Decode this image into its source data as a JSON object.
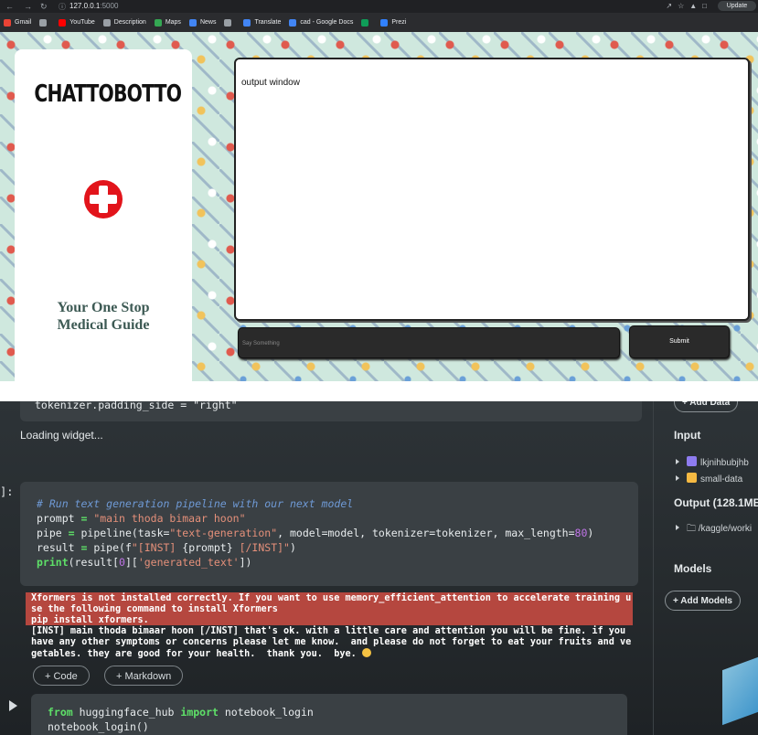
{
  "browser": {
    "url_host": "127.0.0.1",
    "url_port": ":5000",
    "update_label": "Update"
  },
  "bookmarks": [
    {
      "label": "Gmail",
      "color": "#ea4335"
    },
    {
      "label": "",
      "color": "#9aa0a6"
    },
    {
      "label": "YouTube",
      "color": "#ff0000"
    },
    {
      "label": "Description",
      "color": "#9aa0a6"
    },
    {
      "label": "Maps",
      "color": "#34a853"
    },
    {
      "label": "News",
      "color": "#4285f4"
    },
    {
      "label": "",
      "color": "#9aa0a6"
    },
    {
      "label": "Translate",
      "color": "#4285f4"
    },
    {
      "label": "cad - Google Docs",
      "color": "#4285f4"
    },
    {
      "label": "",
      "color": "#0f9d58"
    },
    {
      "label": "Prezi",
      "color": "#3181ff"
    }
  ],
  "app": {
    "brand": "CHATTOBOTTO",
    "tagline_line1": "Your One Stop",
    "tagline_line2": "Medical Guide",
    "output_text": "output window",
    "input_placeholder": "Say Something",
    "submit_label": "Submit",
    "accent_red": "#e2141b"
  },
  "notebook": {
    "top_code": "tokenizer.padding_side = \"right\"",
    "loading_text": "Loading widget...",
    "cell_prompt": "]:",
    "code_lines": {
      "comment": "# Run text generation pipeline with our next model",
      "l1_var": "prompt",
      "l1_str": "\"main thoda bimaar hoon\"",
      "l2_a": "pipe",
      "l2_b": "pipeline(task=",
      "l2_str": "\"text-generation\"",
      "l2_c": ", model=model, tokenizer=tokenizer, max_length=",
      "l2_num": "80",
      "l2_d": ")",
      "l3_a": "result",
      "l3_b": "pipe(f",
      "l3_str1": "\"[INST] ",
      "l3_mid": "{prompt}",
      "l3_str2": " [/INST]\"",
      "l3_c": ")",
      "l4_kw": "print",
      "l4_a": "(result[",
      "l4_num": "0",
      "l4_b": "][",
      "l4_str": "'generated_text'",
      "l4_c": "])"
    },
    "error_lines": [
      "Xformers is not installed correctly. If you want to use memory_efficient_attention to accelerate training u",
      "se the following command to install Xformers",
      "pip install xformers."
    ],
    "output_lines": [
      "[INST] main thoda bimaar hoon [/INST] that's ok. with a little care and attention you will be fine. if you",
      "have any other symptoms or concerns please let me know.  and please do not forget to eat your fruits and ve",
      "getables. they are good for your health.  thank you.  bye. "
    ],
    "add_code_label": "+ Code",
    "add_markdown_label": "+ Markdown",
    "bottom_code_l1_kw1": "from",
    "bottom_code_l1_mod": " huggingface_hub ",
    "bottom_code_l1_kw2": "import",
    "bottom_code_l1_fn": " notebook_login",
    "bottom_code_l2": "notebook_login()"
  },
  "right_panel": {
    "add_data_label": "+ Add Data",
    "input_header": "Input",
    "input_items": [
      "lkjnihbubjhb",
      "small-data"
    ],
    "output_header": "Output (128.1MB /",
    "output_item": "/kaggle/worki",
    "models_header": "Models",
    "add_models_label": "+ Add Models"
  }
}
